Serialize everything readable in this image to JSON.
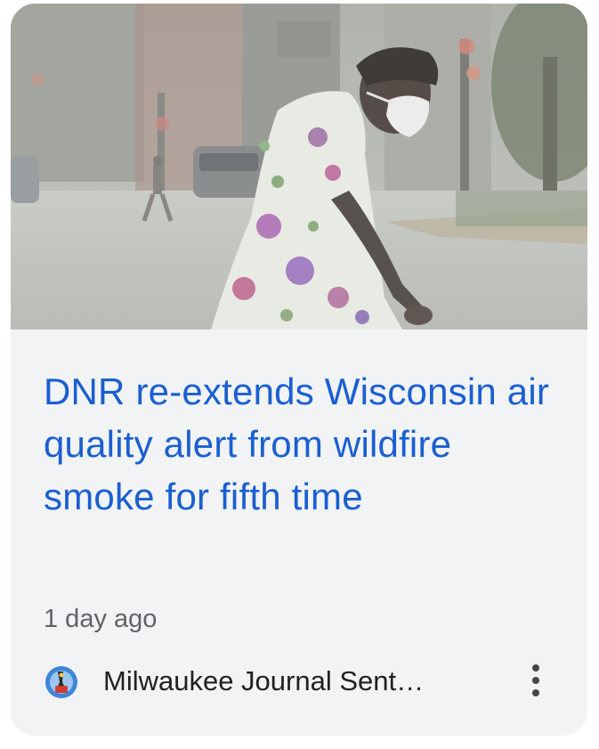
{
  "article": {
    "headline": "DNR re-extends Wisconsin air quality alert from wildfire smoke for fifth time",
    "time": "1 day ago",
    "source": "Milwaukee Journal Sent…",
    "image_alt": "person wearing a mask crossing a smoky street",
    "more_icon": "more-vert-icon",
    "source_logo_icon": "newspaper-logo-icon"
  },
  "colors": {
    "headline": "#1a5fd1",
    "card_background": "#f1f3f4",
    "secondary_text": "#5f6368"
  }
}
